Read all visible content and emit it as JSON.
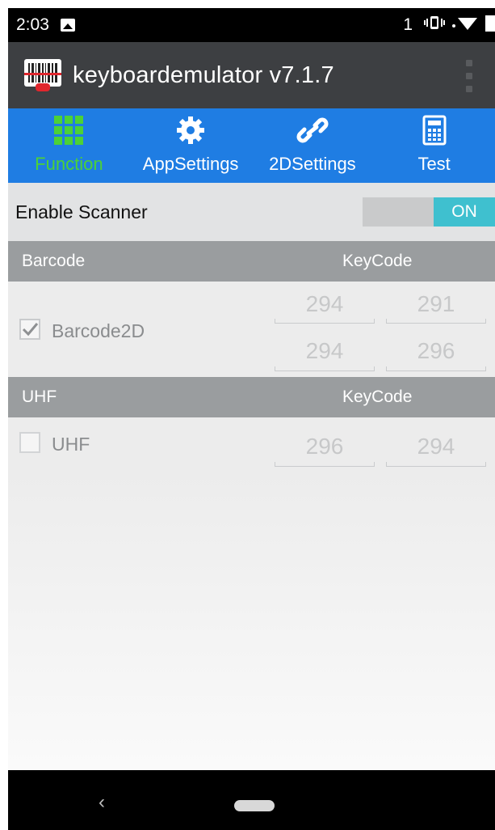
{
  "status_bar": {
    "time": "2:03",
    "notification_count": "1",
    "icons": [
      "image-icon",
      "vibrate-icon",
      "wifi-icon",
      "battery-icon"
    ]
  },
  "app_bar": {
    "title": "keyboardemulator v7.1.7",
    "logo_icon": "barcode-scanner-icon",
    "menu_icon": "overflow-menu-icon"
  },
  "tabs": [
    {
      "label": "Function",
      "icon": "grid-icon",
      "active": true
    },
    {
      "label": "AppSettings",
      "icon": "gear-icon",
      "active": false
    },
    {
      "label": "2DSettings",
      "icon": "link-icon",
      "active": false
    },
    {
      "label": "Test",
      "icon": "calculator-icon",
      "active": false
    }
  ],
  "scanner": {
    "label": "Enable Scanner",
    "toggle_label": "ON",
    "enabled": true
  },
  "barcode_section": {
    "header_left": "Barcode",
    "header_right": "KeyCode",
    "item": {
      "label": "Barcode2D",
      "checked": true,
      "keycodes": [
        "294",
        "291",
        "294",
        "296"
      ]
    }
  },
  "uhf_section": {
    "header_left": "UHF",
    "header_right": "KeyCode",
    "item": {
      "label": "UHF",
      "checked": false,
      "keycodes": [
        "296",
        "294"
      ]
    }
  },
  "colors": {
    "tab_bar": "#1f7de3",
    "active_tab": "#4cd137",
    "toggle_on": "#3fc0cf",
    "app_bar": "#3d3f42",
    "section_header": "#9a9d9f"
  }
}
